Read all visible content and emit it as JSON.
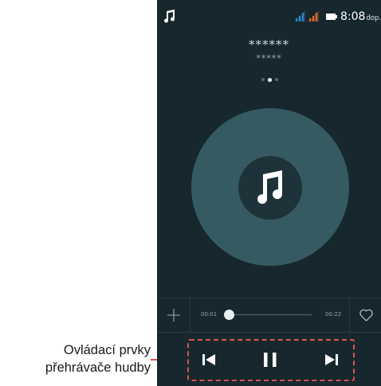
{
  "status_bar": {
    "time": "8:08",
    "time_suffix": "dop.",
    "icons": [
      "music-note-icon",
      "signal-icon",
      "signal-icon",
      "battery-icon"
    ],
    "signal1_color": "#2f86c8",
    "signal2_color": "#e06a2a"
  },
  "song": {
    "title": "******",
    "artist": "*****"
  },
  "pager": {
    "count": 3,
    "active_index": 1
  },
  "progress": {
    "elapsed": "00:01",
    "total": "00:22",
    "fraction": 0.06
  },
  "controls": {
    "icons": [
      "add-icon",
      "heart-icon",
      "skip-previous-icon",
      "pause-icon",
      "skip-next-icon"
    ]
  },
  "annotation": {
    "line1": "Ovládací prvky",
    "line2": "přehrávače hudby",
    "color": "#d9534f"
  },
  "colors": {
    "background": "#16272e",
    "disc": "#365a62",
    "disc_center": "#1e3339"
  }
}
